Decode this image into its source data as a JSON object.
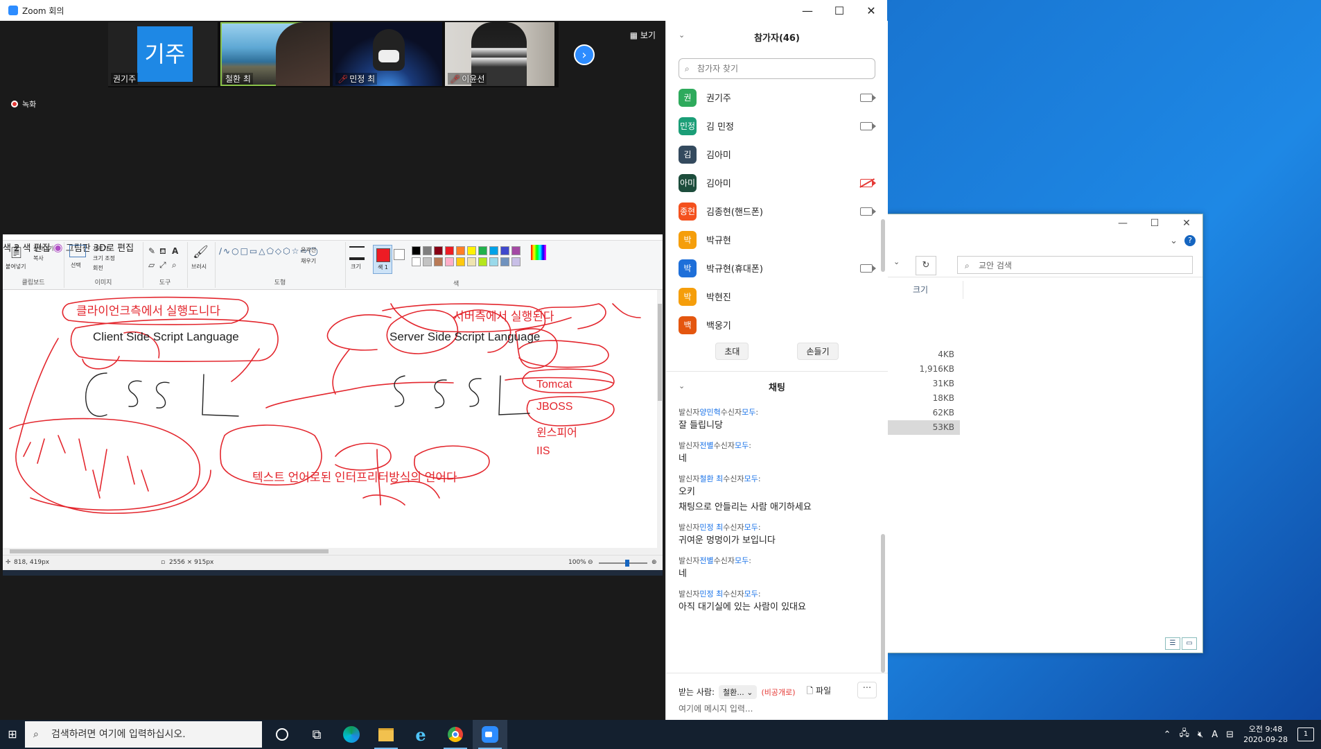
{
  "zoom": {
    "title": "Zoom 회의",
    "view_label": "보기",
    "recording_label": "녹화",
    "thumbnails": [
      {
        "name": "권기주",
        "avatar_text": "기주",
        "muted": false
      },
      {
        "name": "철환 최",
        "muted": false
      },
      {
        "name": "민정 최",
        "muted": true
      },
      {
        "name": "이윤선",
        "muted": true
      }
    ]
  },
  "paint": {
    "ribbon": {
      "paste": "붙여넣기",
      "cut": "잘라내기",
      "copy": "복사",
      "clipboard": "클립보드",
      "select": "선택",
      "crop": "자르기",
      "resize": "크기 조정",
      "rotate": "회전",
      "image": "이미지",
      "tools": "도구",
      "brushes": "브러시",
      "outline": "윤곽선",
      "fill": "채우기",
      "shapes": "도형",
      "size": "크기",
      "color1": "색 1",
      "color2": "색 2",
      "colors": "색",
      "edit_colors": "색 편집",
      "paint3d": "그림판 3D로 편집"
    },
    "status": {
      "cursor": "818, 419px",
      "dimensions": "2556 × 915px",
      "zoom": "100%"
    },
    "canvas_text": {
      "client_ko": "클라이언크측에서 실행도니다",
      "client_en": "Client Side Script Language",
      "server_ko": "서버측에서 실행된다",
      "server_en": "Server Side Script Language",
      "cssl": "CSSL",
      "sssl": "SSSL",
      "tomcat": "Tomcat",
      "jboss": "JBOSS",
      "winspire": "윈스피어",
      "iis": "IIS",
      "interpreter": "텍스트 언어로된 인터프리터방식의 언어다"
    },
    "colors": {
      "palette": [
        "#000000",
        "#7f7f7f",
        "#880015",
        "#ed1c24",
        "#ff7f27",
        "#fff200",
        "#22b14c",
        "#00a2e8",
        "#3f48cc",
        "#a349a4",
        "#ffffff",
        "#c3c3c3",
        "#b97a57",
        "#ffaec9",
        "#ffc90e",
        "#efe4b0",
        "#b5e61d",
        "#99d9ea",
        "#7092be",
        "#c8bfe7"
      ],
      "current": "#ed1c24",
      "ink": "#e3262d"
    }
  },
  "participants": {
    "header": "참가자(46)",
    "search_placeholder": "참가자 찾기",
    "list": [
      {
        "avatar": "권",
        "color": "#2eaa5c",
        "name": "권기주",
        "cam": "on"
      },
      {
        "avatar": "민정",
        "color": "#1b9e77",
        "name": "김 민정",
        "cam": "on"
      },
      {
        "avatar": "김",
        "color": "#344a5e",
        "name": "김아미",
        "cam": "none"
      },
      {
        "avatar": "아미",
        "color": "#1d4d3c",
        "name": "김아미",
        "cam": "off"
      },
      {
        "avatar": "종현",
        "color": "#f4511e",
        "name": "김종현(핸드폰)",
        "cam": "on"
      },
      {
        "avatar": "박",
        "color": "#f59e0b",
        "name": "박규현",
        "cam": "none"
      },
      {
        "avatar": "박",
        "color": "#1e6fd9",
        "name": "박규현(휴대폰)",
        "cam": "on"
      },
      {
        "avatar": "박",
        "color": "#f59e0b",
        "name": "박현진",
        "cam": "none"
      },
      {
        "avatar": "백",
        "color": "#e4560f",
        "name": "백웅기",
        "cam": "none"
      }
    ],
    "invite_label": "초대",
    "raise_hand_label": "손들기"
  },
  "chat": {
    "header": "채팅",
    "messages": [
      {
        "prefix": "발신자",
        "sender": "양민혁",
        "mid": "수신자",
        "to": "모두",
        "suffix": ":",
        "body": "잘 들립니당"
      },
      {
        "prefix": "발신자",
        "sender": "전별",
        "mid": "수신자",
        "to": "모두",
        "suffix": ":",
        "body": "네"
      },
      {
        "prefix": "발신자",
        "sender": "철환 최",
        "mid": "수신자",
        "to": "모두",
        "suffix": ":",
        "body": "오키",
        "body2": "채팅으로 안들리는 사람 애기하세요"
      },
      {
        "prefix": "발신자",
        "sender": "민정 최",
        "mid": "수신자",
        "to": "모두",
        "suffix": ":",
        "body": "귀여운 멍멍이가 보입니다"
      },
      {
        "prefix": "발신자",
        "sender": "전별",
        "mid": "수신자",
        "to": "모두",
        "suffix": ":",
        "body": "네"
      },
      {
        "prefix": "발신자",
        "sender": "민정 최",
        "mid": "수신자",
        "to": "모두",
        "suffix": ":",
        "body": "아직 대기실에 있는 사람이 있대요"
      }
    ],
    "to_label": "받는 사람:",
    "to_value": "철환...",
    "private_label": "(비공개로)",
    "file_label": "파일",
    "input_placeholder": "여기에 메시지 입력..."
  },
  "explorer": {
    "search_placeholder": "교안 검색",
    "column_size": "크기",
    "sizes": [
      "4KB",
      "1,916KB",
      "31KB",
      "18KB",
      "62KB",
      "53KB"
    ]
  },
  "taskbar": {
    "search_placeholder": "검색하려면 여기에 입력하십시오.",
    "time": "오전 9:48",
    "date": "2020-09-28",
    "ime": "A",
    "notification_count": "1"
  }
}
